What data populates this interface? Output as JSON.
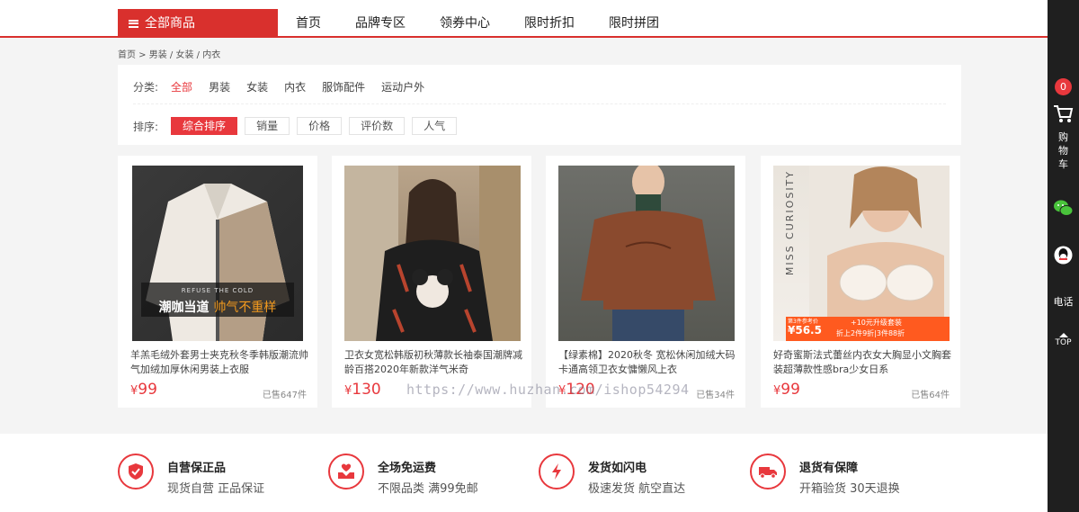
{
  "nav": {
    "all_label": "全部商品",
    "links": [
      "首页",
      "品牌专区",
      "领券中心",
      "限时折扣",
      "限时拼团"
    ]
  },
  "breadcrumb": "首页 > 男装 / 女装 / 内衣",
  "filter": {
    "category_label": "分类:",
    "categories": [
      "全部",
      "男装",
      "女装",
      "内衣",
      "服饰配件",
      "运动户外"
    ],
    "sort_label": "排序:",
    "sorts": [
      "综合排序",
      "销量",
      "价格",
      "评价数",
      "人气"
    ]
  },
  "products": [
    {
      "title": "羊羔毛绒外套男士夹克秋冬季韩版潮流帅气加绒加厚休闲男装上衣服",
      "currency": "¥",
      "price": "99",
      "sold": "已售647件",
      "img_text_top": "REFUSE THE COLD",
      "img_text_main": "潮咖当道",
      "img_text_accent": "帅气不重样"
    },
    {
      "title": "卫衣女宽松韩版初秋薄款长袖泰国潮牌减龄百搭2020年新款洋气米奇",
      "currency": "¥",
      "price": "130",
      "sold": ""
    },
    {
      "title": "【绿素棉】2020秋冬 宽松休闲加绒大码 卡通高领卫衣女慵懒风上衣",
      "currency": "¥",
      "price": "120",
      "sold": "已售34件"
    },
    {
      "title": "好奇蜜斯法式蕾丝内衣女大胸显小文胸套装超薄款性感bra少女日系",
      "currency": "¥",
      "price": "99",
      "sold": "已售64件",
      "img_brand": "MISS CURIOSITY",
      "img_tag1": "第3件参考价",
      "img_price": "56.5",
      "img_tag2": "+10元升级套装",
      "img_tag3": "折上2件9折|3件88折"
    }
  ],
  "watermark": "https://www.huzhan.com/ishop54294",
  "services": [
    {
      "title": "自营保正品",
      "desc": "现货自营 正品保证",
      "icon": "shield-icon"
    },
    {
      "title": "全场免运费",
      "desc": "不限品类 满99免邮",
      "icon": "hands-icon"
    },
    {
      "title": "发货如闪电",
      "desc": "极速发货 航空直达",
      "icon": "lightning-icon"
    },
    {
      "title": "退货有保障",
      "desc": "开箱验货 30天退换",
      "icon": "truck-icon"
    }
  ],
  "rightbar": {
    "cart_count": "0",
    "cart_label": [
      "购",
      "物",
      "车"
    ],
    "phone_label": "电话",
    "top_label": "TOP"
  },
  "colors": {
    "accent": "#e8383d",
    "nav_red": "#d9302d",
    "rightbar": "#1f1f1f"
  }
}
